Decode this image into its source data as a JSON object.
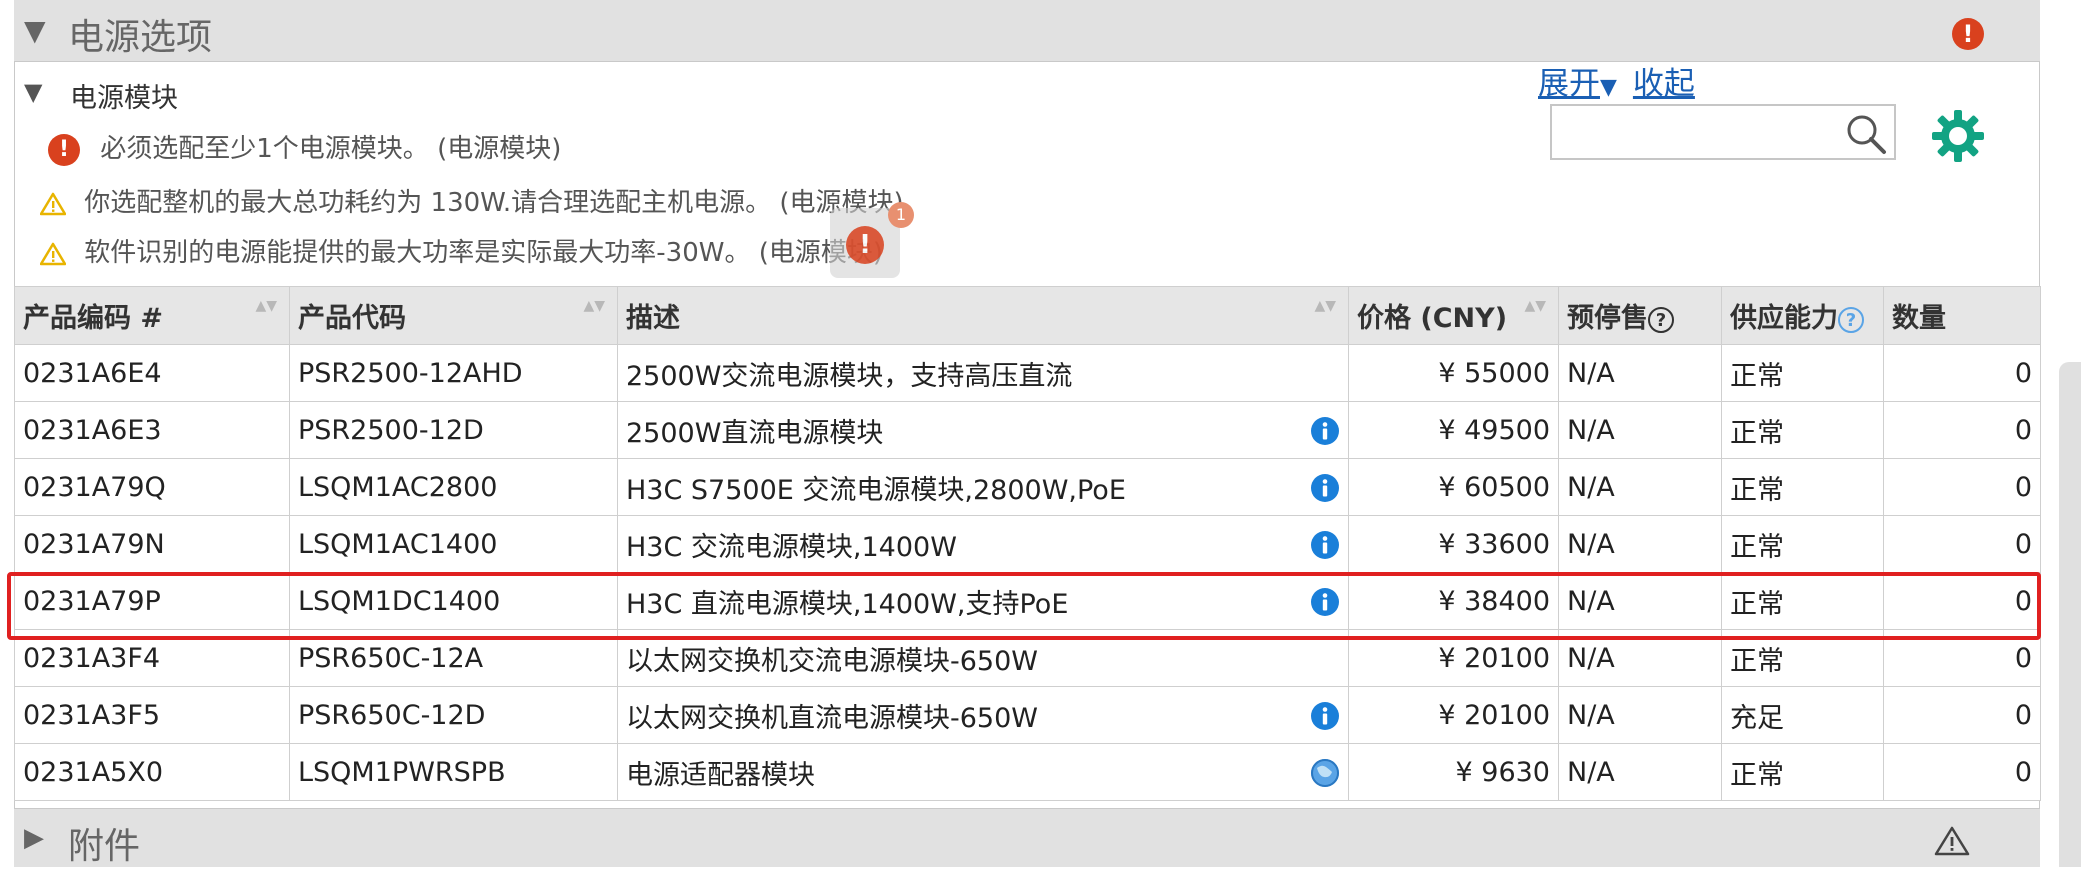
{
  "section_power": {
    "title": "电源选项",
    "arrow": "▼"
  },
  "subsection": {
    "arrow": "▼",
    "title": "电源模块"
  },
  "messages": [
    {
      "type": "error",
      "text": "必须选配至少1个电源模块。 (电源模块)"
    },
    {
      "type": "warning",
      "text": "你选配整机的最大总功耗约为 130W.请合理选配主机电源。 (电源模块)"
    },
    {
      "type": "warning",
      "text": "软件识别的电源能提供的最大功率是实际最大功率-30W。 (电源模块)"
    }
  ],
  "toolbar": {
    "expand": "展开",
    "expand_caret": "▼",
    "collapse": "收起",
    "search_placeholder": ""
  },
  "floating_badge": {
    "icon": "!",
    "count": "1"
  },
  "table": {
    "headers": {
      "code": "产品编码 #",
      "model": "产品代码",
      "desc": "描述",
      "price": "价格 (CNY)",
      "presale": "预停售",
      "supply": "供应能力",
      "qty": "数量"
    },
    "help_glyph": "?",
    "sort_glyph": "▲▼",
    "rows": [
      {
        "code": "0231A6E4",
        "model": "PSR2500-12AHD",
        "desc": "2500W交流电源模块，支持高压直流",
        "icon": "none",
        "price": "¥ 55000",
        "presale": "N/A",
        "supply": "正常",
        "qty": "0"
      },
      {
        "code": "0231A6E3",
        "model": "PSR2500-12D",
        "desc": "2500W直流电源模块",
        "icon": "info",
        "price": "¥ 49500",
        "presale": "N/A",
        "supply": "正常",
        "qty": "0"
      },
      {
        "code": "0231A79Q",
        "model": "LSQM1AC2800",
        "desc": "H3C S7500E 交流电源模块,2800W,PoE",
        "icon": "info",
        "price": "¥ 60500",
        "presale": "N/A",
        "supply": "正常",
        "qty": "0"
      },
      {
        "code": "0231A79N",
        "model": "LSQM1AC1400",
        "desc": "H3C 交流电源模块,1400W",
        "icon": "info",
        "price": "¥ 33600",
        "presale": "N/A",
        "supply": "正常",
        "qty": "0"
      },
      {
        "code": "0231A79P",
        "model": "LSQM1DC1400",
        "desc": "H3C 直流电源模块,1400W,支持PoE",
        "icon": "info",
        "price": "¥ 38400",
        "presale": "N/A",
        "supply": "正常",
        "qty": "0"
      },
      {
        "code": "0231A3F4",
        "model": "PSR650C-12A",
        "desc": "以太网交换机交流电源模块-650W",
        "icon": "none",
        "price": "¥ 20100",
        "presale": "N/A",
        "supply": "正常",
        "qty": "0"
      },
      {
        "code": "0231A3F5",
        "model": "PSR650C-12D",
        "desc": "以太网交换机直流电源模块-650W",
        "icon": "info",
        "price": "¥ 20100",
        "presale": "N/A",
        "supply": "充足",
        "qty": "0"
      },
      {
        "code": "0231A5X0",
        "model": "LSQM1PWRSPB",
        "desc": "电源适配器模块",
        "icon": "globe",
        "price": "¥ 9630",
        "presale": "N/A",
        "supply": "正常",
        "qty": "0"
      }
    ]
  },
  "section_accessory": {
    "title": "附件",
    "arrow": "▶"
  },
  "colors": {
    "error": "#d9411e",
    "warning": "#e8b400",
    "link": "#1a5fb4",
    "gear": "#12a383",
    "info": "#1a7fd9",
    "selection": "#e02020"
  }
}
